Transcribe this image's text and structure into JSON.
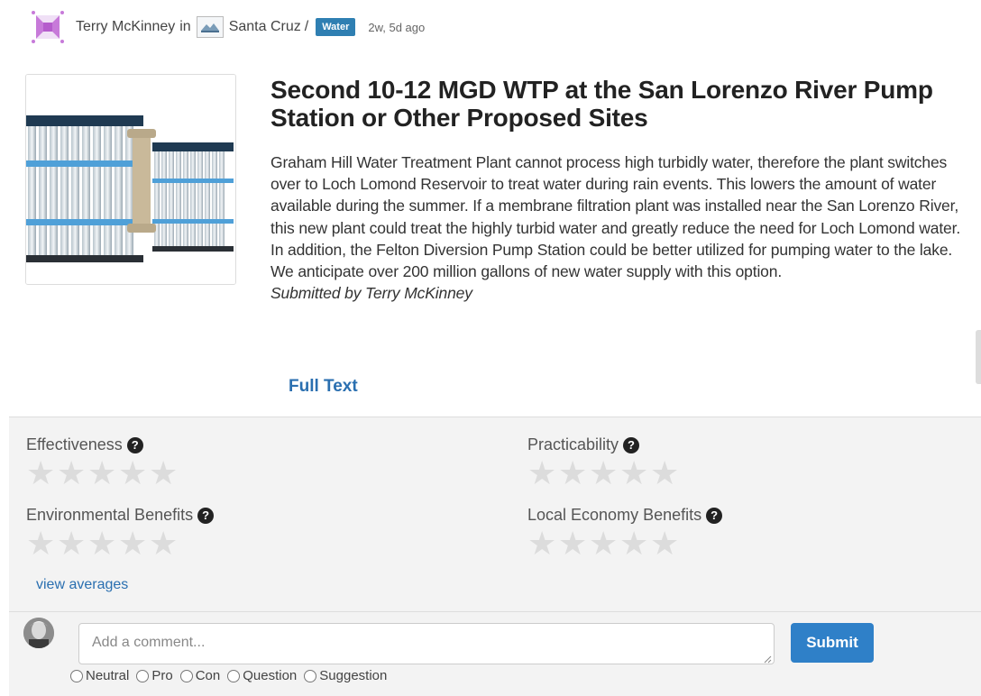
{
  "post": {
    "author": "Terry McKinney",
    "in_word": "in",
    "organization": "Santa Cruz",
    "separator": "/",
    "tag": "Water",
    "time_ago": "2w, 5d ago",
    "title": "Second 10-12 MGD WTP at the San Lorenzo River Pump Station or Other Proposed Sites",
    "description": "Graham Hill Water Treatment Plant cannot process high turbidly water, therefore the plant switches over to Loch Lomond Reservoir to treat water during rain events. This lowers the amount of water available during the summer. If a membrane filtration plant was installed near the San Lorenzo River, this new plant could treat the highly turbid water and greatly reduce the need for Loch Lomond water. In addition, the Felton Diversion Pump Station could be better utilized for pumping water to the lake. We anticipate over 200 million gallons of new water supply with this option.",
    "submitted_by": "Submitted by Terry McKinney",
    "full_text_link": "Full Text"
  },
  "ratings": {
    "criteria": [
      {
        "label": "Effectiveness",
        "stars": 0,
        "max": 5
      },
      {
        "label": "Practicability",
        "stars": 0,
        "max": 5
      },
      {
        "label": "Environmental Benefits",
        "stars": 0,
        "max": 5
      },
      {
        "label": "Local Economy Benefits",
        "stars": 0,
        "max": 5
      }
    ],
    "help_glyph": "?",
    "view_averages": "view averages"
  },
  "comment": {
    "placeholder": "Add a comment...",
    "submit_label": "Submit",
    "types": [
      "Neutral",
      "Pro",
      "Con",
      "Question",
      "Suggestion"
    ]
  },
  "colors": {
    "accent": "#2f80c8",
    "link": "#2a6fb0",
    "tag": "#2f7fb2",
    "panel": "#f3f3f3",
    "star_empty": "#dcdcdc"
  },
  "icons": {
    "author_avatar": "quilt-pattern-icon",
    "org_logo": "santa-cruz-logo-icon",
    "help": "question-circle-icon",
    "star": "star-icon",
    "radio": "radio-icon"
  }
}
